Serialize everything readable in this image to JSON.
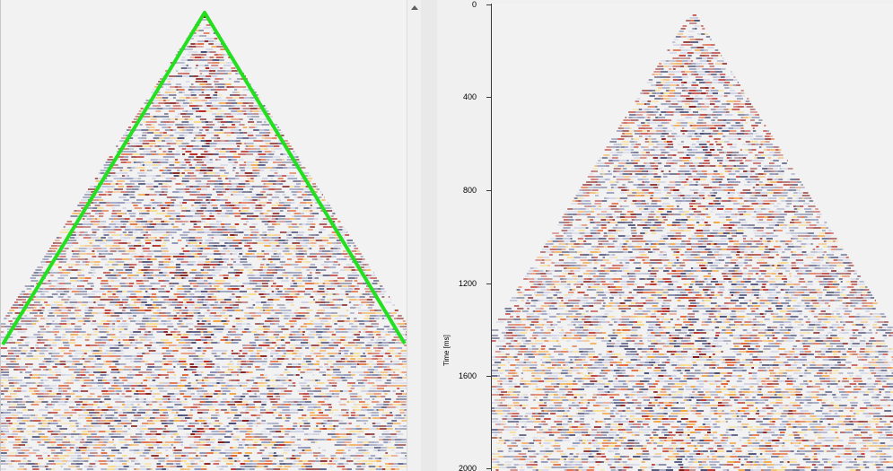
{
  "left_panel": {
    "overlay_color": "#22e020",
    "palette": [
      "#7a0a08",
      "#b51c14",
      "#e0541c",
      "#f2a132",
      "#f7d878",
      "#c7cbe2",
      "#7e86b0",
      "#3a3f6a"
    ]
  },
  "scrollbar": {
    "up_icon": "triangle-up-icon"
  },
  "right_panel": {
    "axis_label": "Time [ms]",
    "ticks": [
      "0",
      "400",
      "800",
      "1200",
      "1600",
      "2000"
    ]
  }
}
